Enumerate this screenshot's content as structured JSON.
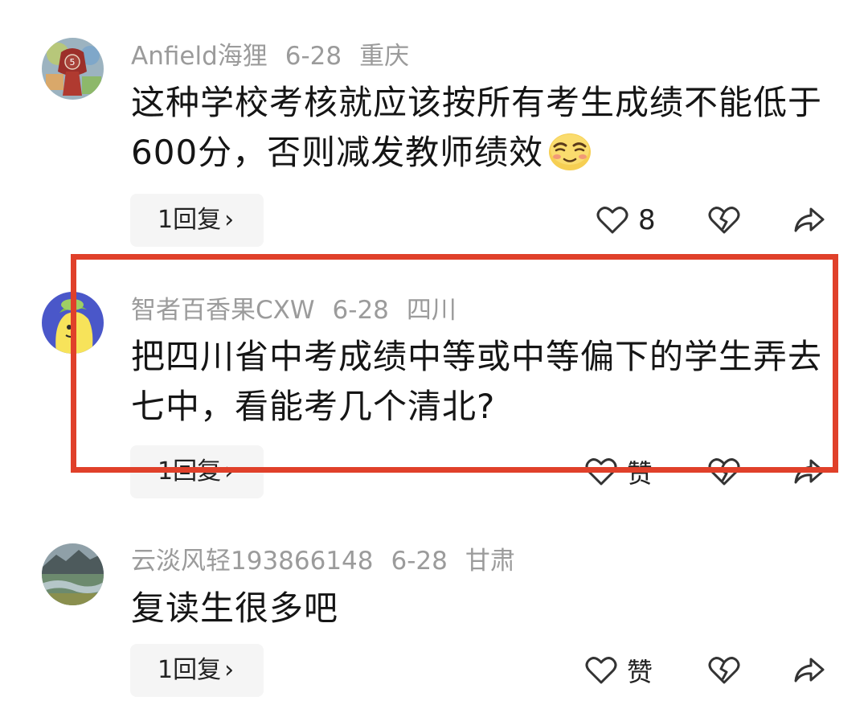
{
  "comments": [
    {
      "username": "Anfield海狸",
      "date": "6-28",
      "location": "重庆",
      "text": "这种学校考核就应该按所有考生成绩不能低于600分，否则减发教师绩效",
      "emoji": "smirk-emoji",
      "reply_label": "1回复",
      "like_label": "8",
      "avatar_badge": "5"
    },
    {
      "username": "智者百香果CXW",
      "date": "6-28",
      "location": "四川",
      "text": "把四川省中考成绩中等或中等偏下的学生弄去七中，看能考几个清北?",
      "reply_label": "1回复",
      "like_label": "赞"
    },
    {
      "username": "云淡风轻193866148",
      "date": "6-28",
      "location": "甘肃",
      "text": "复读生很多吧",
      "reply_label": "1回复",
      "like_label": "赞"
    }
  ],
  "icons": {
    "reply_chevron": "chevron-right-icon",
    "like": "heart-outline-icon",
    "dislike": "broken-heart-icon",
    "share": "share-arrow-icon"
  },
  "colors": {
    "highlight": "#e0402a",
    "meta_text": "#9b9b9b",
    "reply_bg": "#f5f5f5"
  }
}
